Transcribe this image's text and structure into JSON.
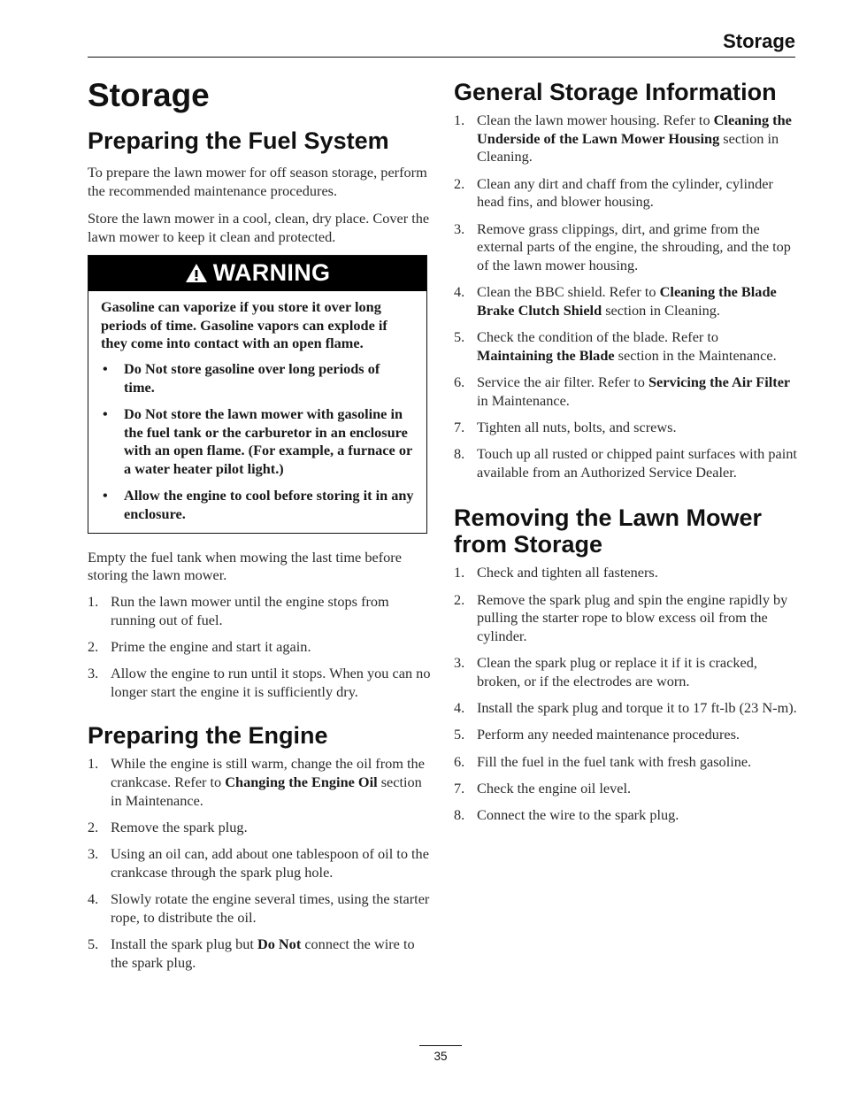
{
  "running_head": "Storage",
  "page_title": "Storage",
  "page_number": "35",
  "left": {
    "fuel_system": {
      "heading": "Preparing the Fuel System",
      "paragraphs": [
        "To prepare the lawn mower for off season storage, perform the recommended maintenance procedures.",
        "Store the lawn mower in a cool, clean, dry place. Cover the lawn mower to keep it clean and protected."
      ],
      "warning": {
        "icon": "warning-triangle-icon",
        "title": "WARNING",
        "intro": "Gasoline can vaporize if you store it over long periods of time. Gasoline vapors can explode if they come into contact with an open flame.",
        "bullets": [
          "Do Not store gasoline over long periods of time.",
          "Do Not store the lawn mower with gasoline in the fuel tank or the carburetor in an enclosure with an open flame. (For example, a furnace or a water heater pilot light.)",
          "Allow the engine to cool before storing it in any enclosure."
        ]
      },
      "after_warning": "Empty the fuel tank when mowing the last time before storing the lawn mower.",
      "steps": [
        [
          {
            "t": "Run the lawn mower until the engine stops from running out of fuel."
          }
        ],
        [
          {
            "t": "Prime the engine and start it again."
          }
        ],
        [
          {
            "t": "Allow the engine to run until it stops. When you can no longer start the engine it is sufficiently dry."
          }
        ]
      ]
    },
    "engine": {
      "heading": "Preparing the Engine",
      "steps": [
        [
          {
            "t": "While the engine is still warm, change the oil from the crankcase.  Refer to "
          },
          {
            "t": "Changing the Engine Oil",
            "b": true
          },
          {
            "t": " section in Maintenance."
          }
        ],
        [
          {
            "t": "Remove the spark plug."
          }
        ],
        [
          {
            "t": "Using an oil can, add about one tablespoon of oil to the crankcase through the spark plug hole."
          }
        ],
        [
          {
            "t": "Slowly rotate the engine several times, using the starter rope, to distribute the oil."
          }
        ],
        [
          {
            "t": "Install the spark plug but "
          },
          {
            "t": "Do Not",
            "b": true
          },
          {
            "t": " connect the wire to the spark plug."
          }
        ]
      ]
    }
  },
  "right": {
    "general": {
      "heading": "General Storage Information",
      "steps": [
        [
          {
            "t": "Clean the lawn mower housing.  Refer to "
          },
          {
            "t": "Cleaning the Underside of the Lawn Mower Housing",
            "b": true
          },
          {
            "t": " section in Cleaning."
          }
        ],
        [
          {
            "t": "Clean any dirt and chaff from the cylinder, cylinder head fins, and blower housing."
          }
        ],
        [
          {
            "t": "Remove grass clippings, dirt, and grime from the external parts of the engine, the shrouding, and the top of the lawn mower housing."
          }
        ],
        [
          {
            "t": "Clean the BBC shield.  Refer to "
          },
          {
            "t": "Cleaning the Blade Brake Clutch Shield",
            "b": true
          },
          {
            "t": " section in Cleaning."
          }
        ],
        [
          {
            "t": "Check the condition of the blade.  Refer to "
          },
          {
            "t": "Maintaining the Blade",
            "b": true
          },
          {
            "t": " section in the Maintenance."
          }
        ],
        [
          {
            "t": "Service the air filter. Refer to "
          },
          {
            "t": "Servicing the Air Filter",
            "b": true
          },
          {
            "t": " in Maintenance."
          }
        ],
        [
          {
            "t": "Tighten all nuts, bolts, and screws."
          }
        ],
        [
          {
            "t": "Touch up all rusted or chipped paint surfaces with paint available from an Authorized Service Dealer."
          }
        ]
      ]
    },
    "removing": {
      "heading": "Removing the Lawn Mower from Storage",
      "steps": [
        [
          {
            "t": "Check and tighten all fasteners."
          }
        ],
        [
          {
            "t": "Remove the spark plug and spin the engine rapidly by pulling the starter rope to blow excess oil from the cylinder."
          }
        ],
        [
          {
            "t": "Clean the spark plug or replace it if it is cracked, broken, or if the electrodes are worn."
          }
        ],
        [
          {
            "t": "Install the spark plug and torque it to 17 ft-lb (23 N-m)."
          }
        ],
        [
          {
            "t": "Perform any needed maintenance procedures."
          }
        ],
        [
          {
            "t": "Fill the fuel in the fuel tank with fresh gasoline."
          }
        ],
        [
          {
            "t": "Check the engine oil level."
          }
        ],
        [
          {
            "t": "Connect the wire to the spark plug."
          }
        ]
      ]
    }
  }
}
